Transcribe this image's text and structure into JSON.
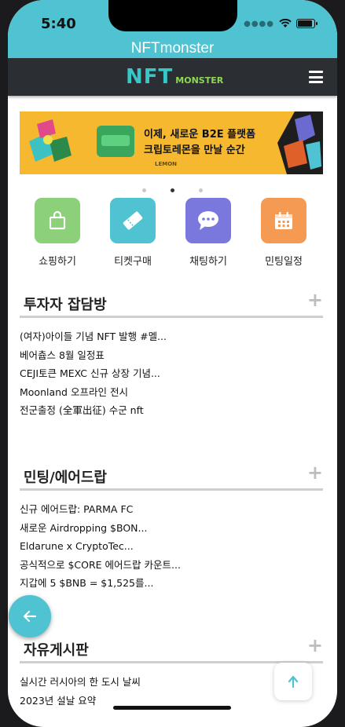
{
  "status_bar": {
    "time": "5:40"
  },
  "app_title": "NFTmonster",
  "navbar": {
    "logo_main": "NFT",
    "logo_sub": "MONSTER",
    "menu_icon": "hamburger-menu-icon"
  },
  "banner": {
    "line1": "이제, 새로운 B2E 플랫폼",
    "line2": "크립토레몬을 만날 순간",
    "brand": "LEMON",
    "slide_count": 3,
    "active_slide": 2
  },
  "quick_menu": [
    {
      "label": "쇼핑하기",
      "icon": "shopping-bag-icon",
      "color": "#8cd07a"
    },
    {
      "label": "티켓구매",
      "icon": "ticket-icon",
      "color": "#4fc3d2"
    },
    {
      "label": "채팅하기",
      "icon": "chat-bubble-icon",
      "color": "#7b78dd"
    },
    {
      "label": "민팅일정",
      "icon": "calendar-icon",
      "color": "#f59a52"
    }
  ],
  "sections": [
    {
      "title": "투자자 잡담방",
      "items": [
        "(여자)아이들 기념 NFT 발행 #멜...",
        "베어츕스 8월 일정표",
        "CEJI토큰 MEXC 신규 상장 기념...",
        "Moonland 오프라인 전시",
        "전군출정 (全軍出征) 수군 nft"
      ]
    },
    {
      "title": "민팅/에어드랍",
      "items": [
        "신규 에어드랍: PARMA FC",
        "새로운 Airdropping $BON...",
        "Eldarune x CryptoTec...",
        "공식적으로 $CORE 에어드랍 카운트...",
        "지갑에 5 $BNB = $1,525를..."
      ]
    },
    {
      "title": "자유게시판",
      "items": [
        "실시간 러시아의 한 도시 날씨",
        "2023년 설날 요약"
      ]
    }
  ],
  "colors": {
    "accent": "#4fc3d2",
    "navbar": "#2b2f33",
    "banner": "#f6b82e"
  }
}
